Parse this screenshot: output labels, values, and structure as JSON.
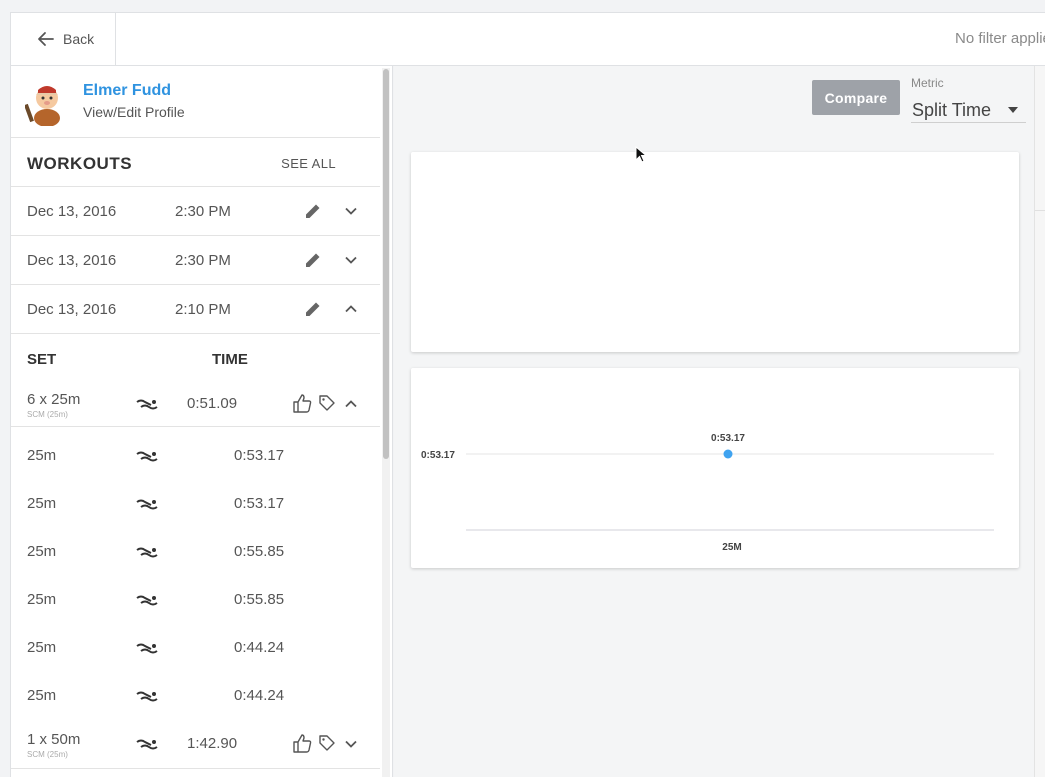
{
  "topbar": {
    "back_label": "Back",
    "filter_text": "No filter applied"
  },
  "profile": {
    "name": "Elmer Fudd",
    "link": "View/Edit Profile"
  },
  "workouts": {
    "title": "WORKOUTS",
    "see_all": "SEE ALL",
    "items": [
      {
        "date": "Dec 13, 2016",
        "time": "2:30 PM",
        "expanded": false
      },
      {
        "date": "Dec 13, 2016",
        "time": "2:30 PM",
        "expanded": false
      },
      {
        "date": "Dec 13, 2016",
        "time": "2:10 PM",
        "expanded": true
      }
    ]
  },
  "sets": {
    "col_set": "SET",
    "col_time": "TIME",
    "groups": [
      {
        "name": "6 x 25m",
        "sub": "SCM (25m)",
        "time": "0:51.09"
      },
      {
        "name": "1 x 50m",
        "sub": "SCM (25m)",
        "time": "1:42.90"
      }
    ],
    "splits": [
      {
        "name": "25m",
        "time": "0:53.17"
      },
      {
        "name": "25m",
        "time": "0:53.17"
      },
      {
        "name": "25m",
        "time": "0:55.85"
      },
      {
        "name": "25m",
        "time": "0:55.85"
      },
      {
        "name": "25m",
        "time": "0:44.24"
      },
      {
        "name": "25m",
        "time": "0:44.24"
      }
    ]
  },
  "controls": {
    "compare_label": "Compare",
    "metric_label": "Metric",
    "metric_value": "Split Time"
  },
  "colors": {
    "accent": "#2f93e0",
    "point": "#3fa3f0",
    "compare_bg": "#9ea2a8"
  },
  "chart_data": {
    "type": "scatter",
    "categories": [
      "25M"
    ],
    "series": [
      {
        "values": [
          53.17
        ],
        "labels": [
          "0:53.17"
        ]
      }
    ],
    "y_tick_labels": [
      "0:53.17"
    ],
    "title": "",
    "xlabel": "",
    "ylabel": ""
  }
}
